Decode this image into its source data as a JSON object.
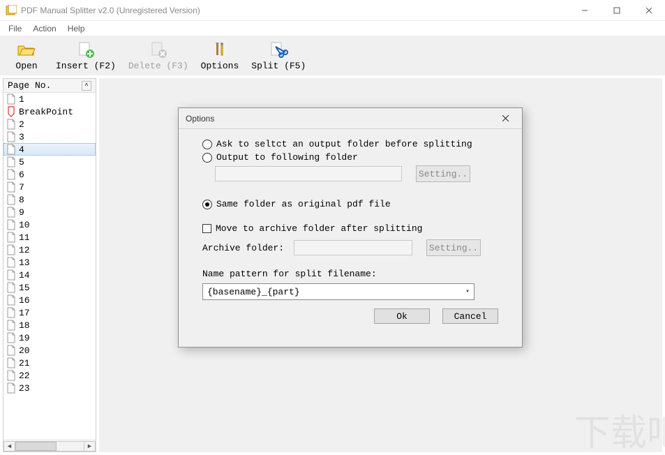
{
  "window": {
    "title": "PDF Manual Splitter v2.0 (Unregistered Version)"
  },
  "menu": {
    "items": [
      "File",
      "Action",
      "Help"
    ]
  },
  "toolbar": {
    "open": {
      "label": "Open"
    },
    "insert": {
      "label": "Insert (F2)"
    },
    "delete": {
      "label": "Delete (F3)",
      "disabled": true
    },
    "options": {
      "label": "Options"
    },
    "split": {
      "label": "Split (F5)"
    }
  },
  "sidebar": {
    "header": "Page No.",
    "items": [
      {
        "label": "1",
        "type": "page"
      },
      {
        "label": "BreakPoint",
        "type": "breakpoint"
      },
      {
        "label": "2",
        "type": "page"
      },
      {
        "label": "3",
        "type": "page"
      },
      {
        "label": "4",
        "type": "page",
        "selected": true
      },
      {
        "label": "5",
        "type": "page"
      },
      {
        "label": "6",
        "type": "page"
      },
      {
        "label": "7",
        "type": "page"
      },
      {
        "label": "8",
        "type": "page"
      },
      {
        "label": "9",
        "type": "page"
      },
      {
        "label": "10",
        "type": "page"
      },
      {
        "label": "11",
        "type": "page"
      },
      {
        "label": "12",
        "type": "page"
      },
      {
        "label": "13",
        "type": "page"
      },
      {
        "label": "14",
        "type": "page"
      },
      {
        "label": "15",
        "type": "page"
      },
      {
        "label": "16",
        "type": "page"
      },
      {
        "label": "17",
        "type": "page"
      },
      {
        "label": "18",
        "type": "page"
      },
      {
        "label": "19",
        "type": "page"
      },
      {
        "label": "20",
        "type": "page"
      },
      {
        "label": "21",
        "type": "page"
      },
      {
        "label": "22",
        "type": "page"
      },
      {
        "label": "23",
        "type": "page"
      }
    ]
  },
  "dialog": {
    "title": "Options",
    "radios": {
      "ask": "Ask to seltct an output folder before splitting",
      "output": "Output to following folder",
      "same": "Same folder as original pdf file"
    },
    "selected_radio": "same",
    "checkbox_move": {
      "label": "Move to archive folder after splitting",
      "checked": false
    },
    "archive_label": "Archive folder:",
    "setting_btn": "Setting..",
    "pattern_label": "Name pattern for split filename:",
    "pattern_value": "{basename}_{part}",
    "ok": "Ok",
    "cancel": "Cancel"
  }
}
